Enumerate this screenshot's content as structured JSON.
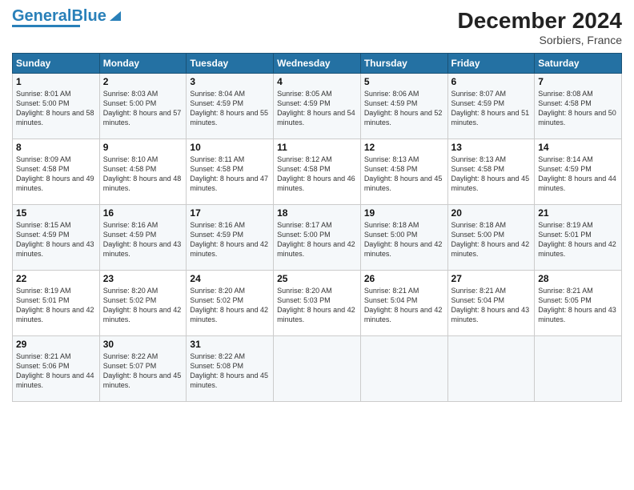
{
  "logo": {
    "text1": "General",
    "text2": "Blue"
  },
  "header": {
    "title": "December 2024",
    "subtitle": "Sorbiers, France"
  },
  "weekdays": [
    "Sunday",
    "Monday",
    "Tuesday",
    "Wednesday",
    "Thursday",
    "Friday",
    "Saturday"
  ],
  "weeks": [
    [
      {
        "day": "1",
        "sunrise": "8:01 AM",
        "sunset": "5:00 PM",
        "daylight": "8 hours and 58 minutes."
      },
      {
        "day": "2",
        "sunrise": "8:03 AM",
        "sunset": "5:00 PM",
        "daylight": "8 hours and 57 minutes."
      },
      {
        "day": "3",
        "sunrise": "8:04 AM",
        "sunset": "4:59 PM",
        "daylight": "8 hours and 55 minutes."
      },
      {
        "day": "4",
        "sunrise": "8:05 AM",
        "sunset": "4:59 PM",
        "daylight": "8 hours and 54 minutes."
      },
      {
        "day": "5",
        "sunrise": "8:06 AM",
        "sunset": "4:59 PM",
        "daylight": "8 hours and 52 minutes."
      },
      {
        "day": "6",
        "sunrise": "8:07 AM",
        "sunset": "4:59 PM",
        "daylight": "8 hours and 51 minutes."
      },
      {
        "day": "7",
        "sunrise": "8:08 AM",
        "sunset": "4:58 PM",
        "daylight": "8 hours and 50 minutes."
      }
    ],
    [
      {
        "day": "8",
        "sunrise": "8:09 AM",
        "sunset": "4:58 PM",
        "daylight": "8 hours and 49 minutes."
      },
      {
        "day": "9",
        "sunrise": "8:10 AM",
        "sunset": "4:58 PM",
        "daylight": "8 hours and 48 minutes."
      },
      {
        "day": "10",
        "sunrise": "8:11 AM",
        "sunset": "4:58 PM",
        "daylight": "8 hours and 47 minutes."
      },
      {
        "day": "11",
        "sunrise": "8:12 AM",
        "sunset": "4:58 PM",
        "daylight": "8 hours and 46 minutes."
      },
      {
        "day": "12",
        "sunrise": "8:13 AM",
        "sunset": "4:58 PM",
        "daylight": "8 hours and 45 minutes."
      },
      {
        "day": "13",
        "sunrise": "8:13 AM",
        "sunset": "4:58 PM",
        "daylight": "8 hours and 45 minutes."
      },
      {
        "day": "14",
        "sunrise": "8:14 AM",
        "sunset": "4:59 PM",
        "daylight": "8 hours and 44 minutes."
      }
    ],
    [
      {
        "day": "15",
        "sunrise": "8:15 AM",
        "sunset": "4:59 PM",
        "daylight": "8 hours and 43 minutes."
      },
      {
        "day": "16",
        "sunrise": "8:16 AM",
        "sunset": "4:59 PM",
        "daylight": "8 hours and 43 minutes."
      },
      {
        "day": "17",
        "sunrise": "8:16 AM",
        "sunset": "4:59 PM",
        "daylight": "8 hours and 42 minutes."
      },
      {
        "day": "18",
        "sunrise": "8:17 AM",
        "sunset": "5:00 PM",
        "daylight": "8 hours and 42 minutes."
      },
      {
        "day": "19",
        "sunrise": "8:18 AM",
        "sunset": "5:00 PM",
        "daylight": "8 hours and 42 minutes."
      },
      {
        "day": "20",
        "sunrise": "8:18 AM",
        "sunset": "5:00 PM",
        "daylight": "8 hours and 42 minutes."
      },
      {
        "day": "21",
        "sunrise": "8:19 AM",
        "sunset": "5:01 PM",
        "daylight": "8 hours and 42 minutes."
      }
    ],
    [
      {
        "day": "22",
        "sunrise": "8:19 AM",
        "sunset": "5:01 PM",
        "daylight": "8 hours and 42 minutes."
      },
      {
        "day": "23",
        "sunrise": "8:20 AM",
        "sunset": "5:02 PM",
        "daylight": "8 hours and 42 minutes."
      },
      {
        "day": "24",
        "sunrise": "8:20 AM",
        "sunset": "5:02 PM",
        "daylight": "8 hours and 42 minutes."
      },
      {
        "day": "25",
        "sunrise": "8:20 AM",
        "sunset": "5:03 PM",
        "daylight": "8 hours and 42 minutes."
      },
      {
        "day": "26",
        "sunrise": "8:21 AM",
        "sunset": "5:04 PM",
        "daylight": "8 hours and 42 minutes."
      },
      {
        "day": "27",
        "sunrise": "8:21 AM",
        "sunset": "5:04 PM",
        "daylight": "8 hours and 43 minutes."
      },
      {
        "day": "28",
        "sunrise": "8:21 AM",
        "sunset": "5:05 PM",
        "daylight": "8 hours and 43 minutes."
      }
    ],
    [
      {
        "day": "29",
        "sunrise": "8:21 AM",
        "sunset": "5:06 PM",
        "daylight": "8 hours and 44 minutes."
      },
      {
        "day": "30",
        "sunrise": "8:22 AM",
        "sunset": "5:07 PM",
        "daylight": "8 hours and 45 minutes."
      },
      {
        "day": "31",
        "sunrise": "8:22 AM",
        "sunset": "5:08 PM",
        "daylight": "8 hours and 45 minutes."
      },
      null,
      null,
      null,
      null
    ]
  ]
}
